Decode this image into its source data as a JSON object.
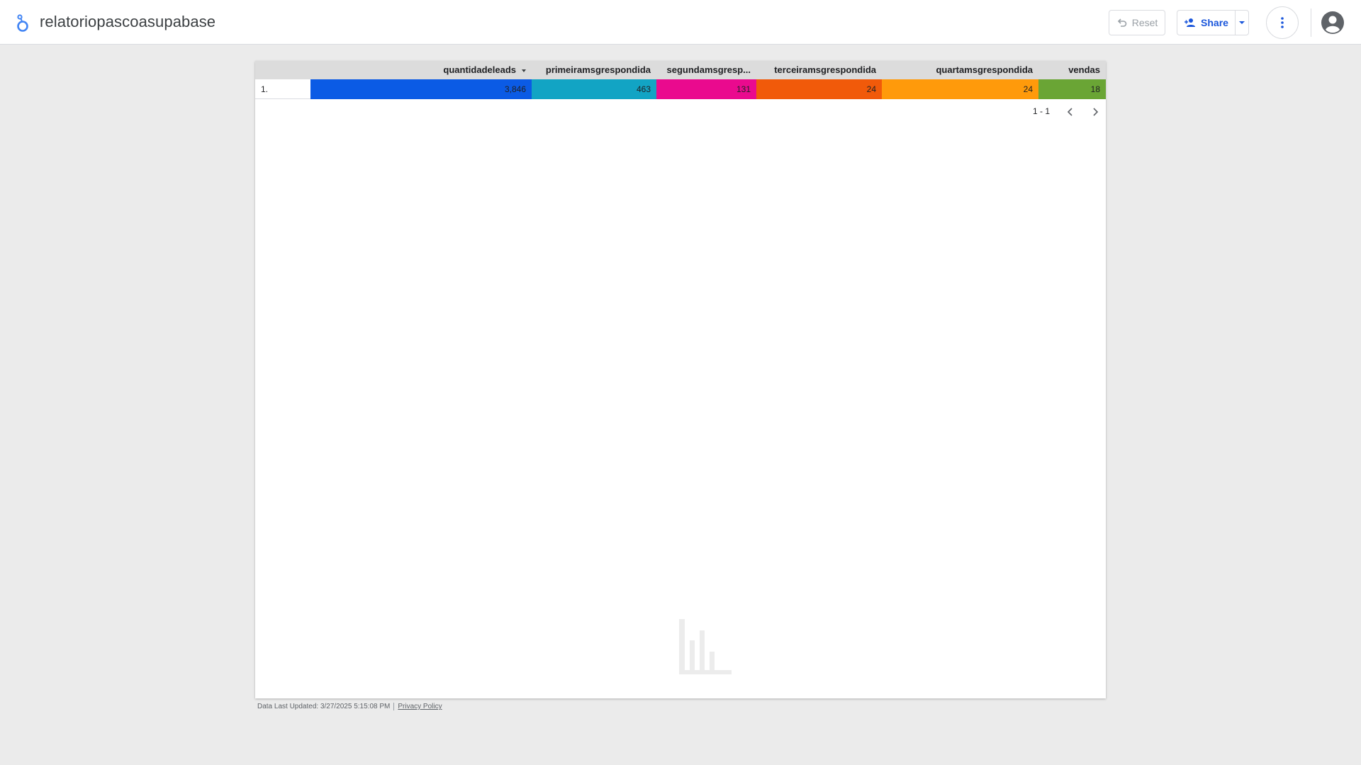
{
  "app": {
    "title": "relatoriopascoasupabase",
    "page_loading_progress": 0.547
  },
  "toolbar": {
    "reset_label": "Reset",
    "share_label": "Share",
    "icons": {
      "reset": "undo-icon",
      "share": "person-add-icon",
      "share_menu": "caret-down-icon",
      "more": "more-vert-icon",
      "account": "account-circle-icon"
    }
  },
  "table": {
    "columns": [
      {
        "key": "quantidadeleads",
        "label": "quantidadeleads",
        "sorted": "desc",
        "color": "#0b5be5"
      },
      {
        "key": "primeiramsgrespondida",
        "label": "primeiramsgrespondida",
        "color": "#12a4c4"
      },
      {
        "key": "segundamsgrespondida",
        "label": "segundamsgresp...",
        "color": "#ea0a8e"
      },
      {
        "key": "terceiramsgrespondida",
        "label": "terceiramsgrespondida",
        "color": "#f15a0a"
      },
      {
        "key": "quartamsgrespondida",
        "label": "quartamsgrespondida",
        "color": "#ff9a0b"
      },
      {
        "key": "vendas",
        "label": "vendas",
        "color": "#6aa535"
      }
    ],
    "rows": [
      {
        "index": "1.",
        "values": [
          "3,846",
          "463",
          "131",
          "24",
          "24",
          "18"
        ]
      }
    ],
    "pagination": {
      "range": "1 - 1"
    },
    "header_background": "#dcdcdc"
  },
  "footer": {
    "last_updated": "Data Last Updated: 3/27/2025 5:15:08 PM",
    "privacy_label": "Privacy Policy"
  },
  "colors": {
    "brand": "#1a56db",
    "page_background": "#ebebeb"
  }
}
